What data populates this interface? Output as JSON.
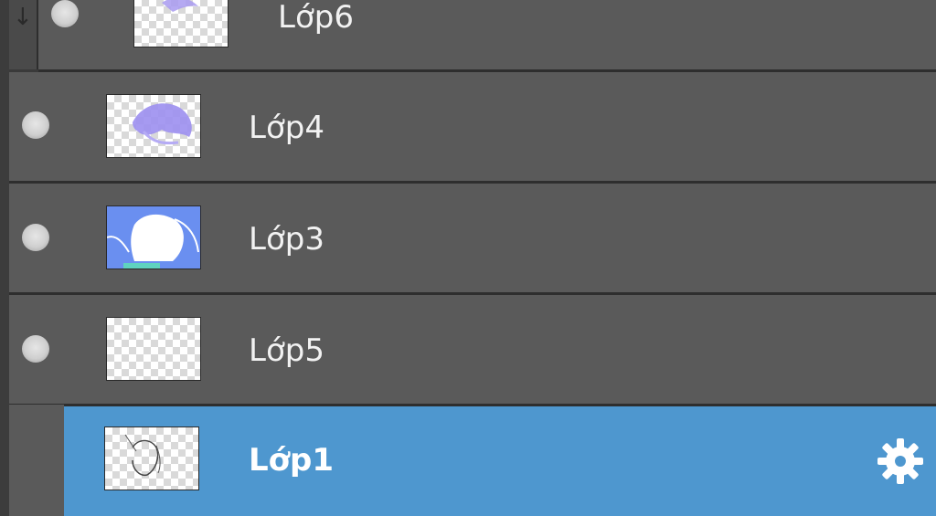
{
  "layers_panel": {
    "layers": [
      {
        "name": "Lớp6",
        "visible": true,
        "selected": false,
        "clipped": true
      },
      {
        "name": "Lớp4",
        "visible": true,
        "selected": false,
        "clipped": false
      },
      {
        "name": "Lớp3",
        "visible": true,
        "selected": false,
        "clipped": false
      },
      {
        "name": "Lớp5",
        "visible": true,
        "selected": false,
        "clipped": false
      },
      {
        "name": "Lớp1",
        "visible": false,
        "selected": true,
        "clipped": false
      }
    ],
    "selected_color": "#4e97cf",
    "row_color": "#5a5a5a",
    "icons": {
      "clip": "arrow-down-icon",
      "visibility": "visibility-dot-icon",
      "settings": "gear-icon"
    }
  }
}
